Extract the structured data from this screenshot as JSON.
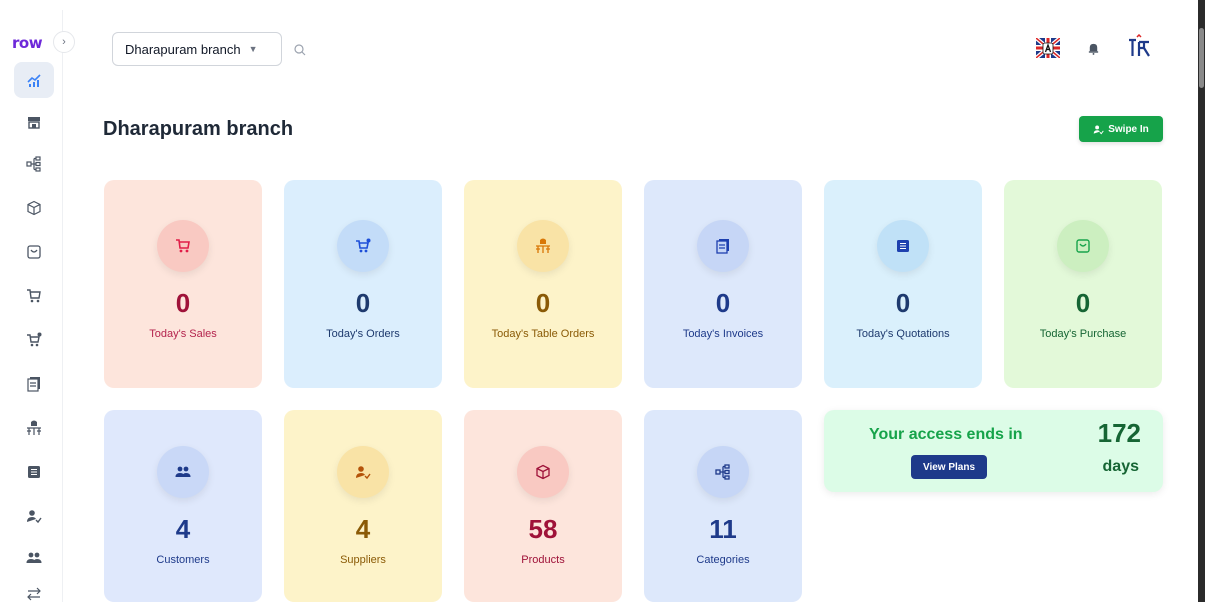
{
  "app": {
    "logo": "row"
  },
  "header": {
    "branch_selected": "Dharapuram branch",
    "flag": "english-flag-icon",
    "notification": "bell-icon",
    "profile": "avatar"
  },
  "page": {
    "title": "Dharapuram branch",
    "swipe_label": "Swipe In"
  },
  "sidebar": {
    "items": [
      {
        "name": "dashboard",
        "icon": "chart-icon",
        "active": true
      },
      {
        "name": "store",
        "icon": "store-icon"
      },
      {
        "name": "categories",
        "icon": "hierarchy-icon"
      },
      {
        "name": "products",
        "icon": "cube-icon"
      },
      {
        "name": "purchase",
        "icon": "bag-icon"
      },
      {
        "name": "sales",
        "icon": "cart-icon"
      },
      {
        "name": "orders",
        "icon": "cart-plus-icon"
      },
      {
        "name": "invoices",
        "icon": "invoice-icon"
      },
      {
        "name": "table-orders",
        "icon": "table-icon"
      },
      {
        "name": "quotations",
        "icon": "document-icon"
      },
      {
        "name": "suppliers",
        "icon": "user-check-icon"
      },
      {
        "name": "customers",
        "icon": "users-icon"
      },
      {
        "name": "transfers",
        "icon": "transfer-icon"
      }
    ]
  },
  "stats": [
    {
      "value": "0",
      "label": "Today's Sales",
      "icon": "cart-icon"
    },
    {
      "value": "0",
      "label": "Today's Orders",
      "icon": "cart-plus-icon"
    },
    {
      "value": "0",
      "label": "Today's Table Orders",
      "icon": "table-icon"
    },
    {
      "value": "0",
      "label": "Today's Invoices",
      "icon": "invoice-icon"
    },
    {
      "value": "0",
      "label": "Today's Quotations",
      "icon": "document-icon"
    },
    {
      "value": "0",
      "label": "Today's Purchase",
      "icon": "bag-icon"
    },
    {
      "value": "4",
      "label": "Customers",
      "icon": "users-icon"
    },
    {
      "value": "4",
      "label": "Suppliers",
      "icon": "user-check-icon"
    },
    {
      "value": "58",
      "label": "Products",
      "icon": "cube-icon"
    },
    {
      "value": "11",
      "label": "Categories",
      "icon": "hierarchy-icon"
    }
  ],
  "plan": {
    "text": "Your access ends in",
    "days": "172",
    "days_label": "days",
    "button": "View Plans"
  },
  "colors": {
    "sales_bg": "#fde5dc",
    "sales_fg": "#9f1239",
    "sales_icon": "#e11d48",
    "orders_bg": "#dbeefd",
    "orders_fg": "#1e3a6e",
    "orders_icon": "#1d4ed8",
    "table_bg": "#fdf3c9",
    "table_fg": "#8a5a06",
    "table_icon": "#d97706",
    "invoices_bg": "#dde8fb",
    "invoices_fg": "#1e3a8a",
    "invoices_icon": "#1e40af",
    "quotations_bg": "#daf0fc",
    "quotations_fg": "#1e3a6e",
    "quotations_icon": "#1e40af",
    "purchase_bg": "#e3f9d9",
    "purchase_fg": "#166534",
    "purchase_icon": "#16a34a",
    "customers_bg": "#dfe8fc",
    "customers_fg": "#1e3a8a",
    "suppliers_bg": "#fdf3c9",
    "suppliers_fg": "#8a5a06",
    "products_bg": "#fde5dc",
    "products_fg": "#9f1239",
    "categories_bg": "#dde8fb",
    "categories_fg": "#1e3a8a",
    "accent_green": "#16a34a",
    "nav_blue": "#1e3a8a"
  }
}
